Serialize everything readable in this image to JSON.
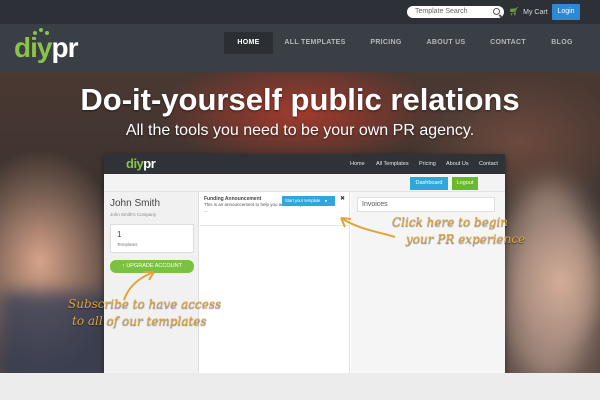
{
  "topbar": {
    "search_placeholder": "Template Search",
    "cart_label": "My Cart",
    "login_label": "Login"
  },
  "brand": {
    "logo_green": "diy",
    "logo_white": "pr"
  },
  "nav": {
    "items": [
      "HOME",
      "ALL TEMPLATES",
      "PRICING",
      "ABOUT US",
      "CONTACT",
      "BLOG"
    ],
    "active": "HOME"
  },
  "hero": {
    "title": "Do-it-yourself public relations",
    "subtitle": "All the tools you need to be your own PR agency."
  },
  "mockup": {
    "logo_green": "diy",
    "logo_white": "pr",
    "nav_items": [
      "Home",
      "All Templates",
      "Pricing",
      "About Us",
      "Contact"
    ],
    "dashboard_label": "Dashboard",
    "logout_label": "Logout",
    "user": {
      "name": "John Smith",
      "company": "John Smith's Company"
    },
    "templates": {
      "count": "1",
      "label": "Templates"
    },
    "upgrade_label": "UPGRADE ACCOUNT",
    "announcement": {
      "title": "Funding Announcement",
      "description": "This is an announcement to help you announce your ...",
      "start_label": "Start your template"
    },
    "invoices_label": "Invoices"
  },
  "callouts": {
    "right_line1": "Click here to begin",
    "right_line2": "your PR experience",
    "left_line1": "Subscribe to have access",
    "left_line2": "to all of our templates"
  },
  "colors": {
    "accent_green": "#8bc34a",
    "login_blue": "#2e88d3",
    "nav_dark": "#3a3f45",
    "callout_orange": "#e2a33a"
  },
  "icons": [
    "search-icon",
    "cart-icon",
    "upgrade-arrow-icon",
    "close-icon",
    "start-template-icon"
  ]
}
